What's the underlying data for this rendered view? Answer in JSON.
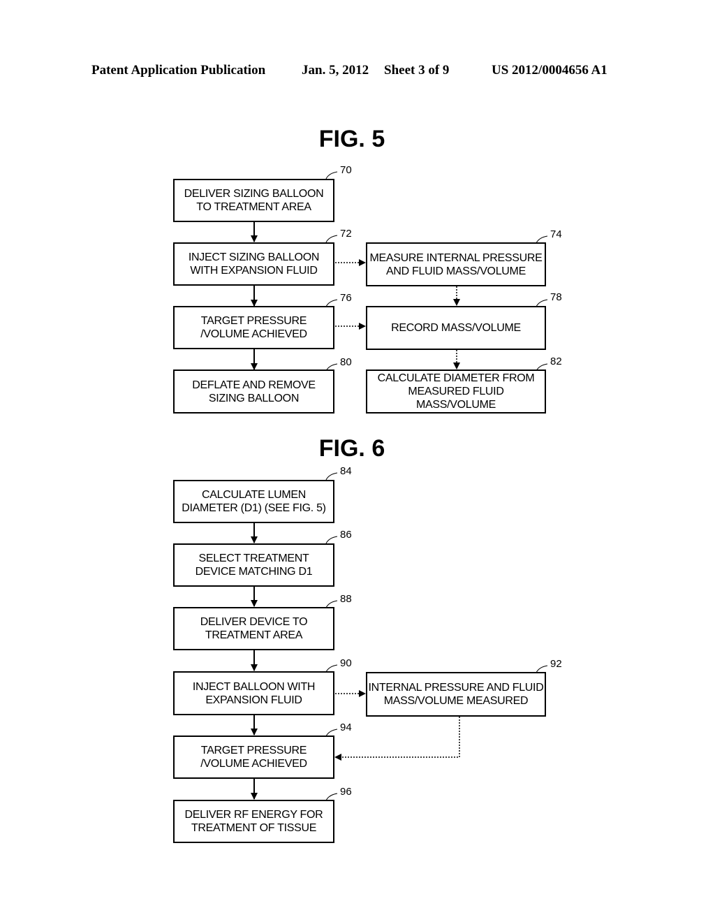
{
  "header": {
    "publication": "Patent Application Publication",
    "date": "Jan. 5, 2012",
    "sheet": "Sheet 3 of 9",
    "number": "US 2012/0004656 A1"
  },
  "fig5": {
    "title": "FIG. 5",
    "steps": [
      {
        "ref": "70",
        "text": "DELIVER SIZING BALLOON\nTO TREATMENT AREA"
      },
      {
        "ref": "72",
        "text": "INJECT SIZING BALLOON\nWITH EXPANSION FLUID"
      },
      {
        "ref": "74",
        "text": "MEASURE INTERNAL PRESSURE\nAND FLUID MASS/VOLUME"
      },
      {
        "ref": "76",
        "text": "TARGET PRESSURE\n/VOLUME ACHIEVED"
      },
      {
        "ref": "78",
        "text": "RECORD MASS/VOLUME"
      },
      {
        "ref": "80",
        "text": "DEFLATE AND REMOVE\nSIZING BALLOON"
      },
      {
        "ref": "82",
        "text": "CALCULATE DIAMETER FROM\nMEASURED FLUID MASS/VOLUME"
      }
    ]
  },
  "fig6": {
    "title": "FIG. 6",
    "steps": [
      {
        "ref": "84",
        "text": "CALCULATE LUMEN\nDIAMETER (D1) (SEE FIG. 5)"
      },
      {
        "ref": "86",
        "text": "SELECT TREATMENT\nDEVICE MATCHING D1"
      },
      {
        "ref": "88",
        "text": "DELIVER DEVICE TO\nTREATMENT AREA"
      },
      {
        "ref": "90",
        "text": "INJECT BALLOON WITH\nEXPANSION FLUID"
      },
      {
        "ref": "92",
        "text": "INTERNAL PRESSURE AND FLUID\nMASS/VOLUME MEASURED"
      },
      {
        "ref": "94",
        "text": "TARGET PRESSURE\n/VOLUME ACHIEVED"
      },
      {
        "ref": "96",
        "text": "DELIVER RF ENERGY FOR\nTREATMENT OF TISSUE"
      }
    ]
  }
}
